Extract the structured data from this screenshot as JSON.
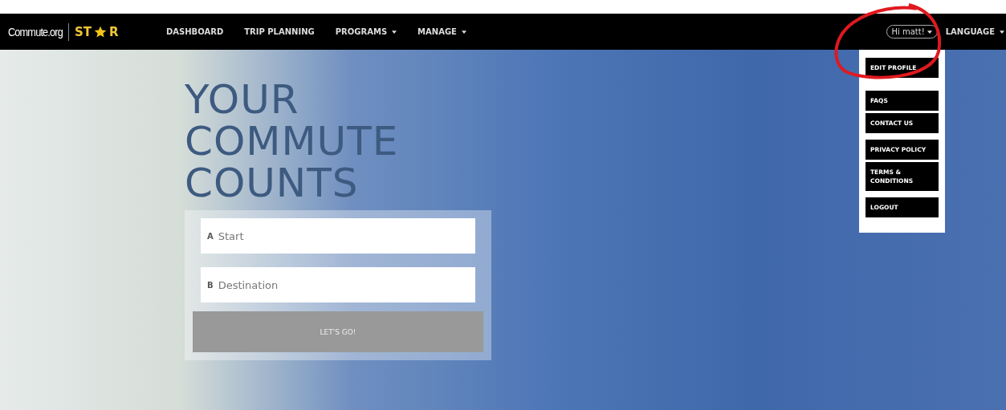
{
  "navbar": {
    "logo": {
      "site": "Commute.org",
      "brand_start": "ST",
      "brand_end": "R"
    },
    "items": [
      {
        "label": "DASHBOARD",
        "has_caret": false
      },
      {
        "label": "TRIP PLANNING",
        "has_caret": false
      },
      {
        "label": "PROGRAMS",
        "has_caret": true
      },
      {
        "label": "MANAGE",
        "has_caret": true
      }
    ],
    "user_button": {
      "label": "Hi matt!"
    },
    "language": {
      "label": "LANGUAGE"
    }
  },
  "user_menu": {
    "groups": [
      [
        "EDIT PROFILE"
      ],
      [
        "FAQS",
        "CONTACT US"
      ],
      [
        "PRIVACY POLICY",
        "TERMS & CONDITIONS"
      ],
      [
        "LOGOUT"
      ]
    ]
  },
  "hero": {
    "headline": [
      "YOUR",
      "COMMUTE",
      "COUNTS"
    ],
    "fields": [
      {
        "marker": "A",
        "placeholder": "Start"
      },
      {
        "marker": "B",
        "placeholder": "Destination"
      }
    ],
    "submit": "LET'S GO!"
  }
}
